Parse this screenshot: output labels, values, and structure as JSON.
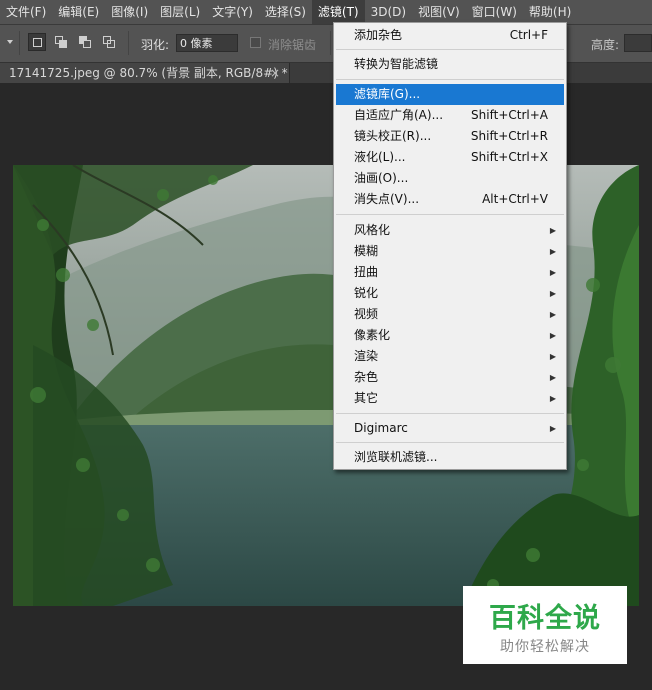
{
  "menubar": {
    "items": [
      "文件(F)",
      "编辑(E)",
      "图像(I)",
      "图层(L)",
      "文字(Y)",
      "选择(S)",
      "滤镜(T)",
      "3D(D)",
      "视图(V)",
      "窗口(W)",
      "帮助(H)"
    ],
    "active": "滤镜(T)"
  },
  "options": {
    "feather_label": "羽化:",
    "feather_value": "0 像素",
    "antialias_label": "消除锯齿",
    "height_label": "高度:"
  },
  "document_tab": {
    "title": "17141725.jpeg @ 80.7% (背景 副本, RGB/8#) *",
    "close_glyph": "×"
  },
  "filter_menu": {
    "items": [
      {
        "label": "添加杂色",
        "shortcut": "Ctrl+F"
      },
      {
        "label": "转换为智能滤镜"
      },
      {
        "label": "滤镜库(G)...",
        "highlighted": true
      },
      {
        "label": "自适应广角(A)...",
        "shortcut": "Shift+Ctrl+A"
      },
      {
        "label": "镜头校正(R)...",
        "shortcut": "Shift+Ctrl+R"
      },
      {
        "label": "液化(L)...",
        "shortcut": "Shift+Ctrl+X"
      },
      {
        "label": "油画(O)..."
      },
      {
        "label": "消失点(V)...",
        "shortcut": "Alt+Ctrl+V"
      },
      {
        "label": "风格化",
        "submenu": true
      },
      {
        "label": "模糊",
        "submenu": true
      },
      {
        "label": "扭曲",
        "submenu": true
      },
      {
        "label": "锐化",
        "submenu": true
      },
      {
        "label": "视频",
        "submenu": true
      },
      {
        "label": "像素化",
        "submenu": true
      },
      {
        "label": "渲染",
        "submenu": true
      },
      {
        "label": "杂色",
        "submenu": true
      },
      {
        "label": "其它",
        "submenu": true
      },
      {
        "label": "Digimarc",
        "submenu": true
      },
      {
        "label": "浏览联机滤镜..."
      }
    ],
    "arrow_glyph": "▶"
  },
  "watermark": {
    "title": "百科全说",
    "subtitle": "助你轻松解决"
  },
  "colors": {
    "highlight": "#1978d2",
    "watermark_green": "#2ea84a"
  }
}
